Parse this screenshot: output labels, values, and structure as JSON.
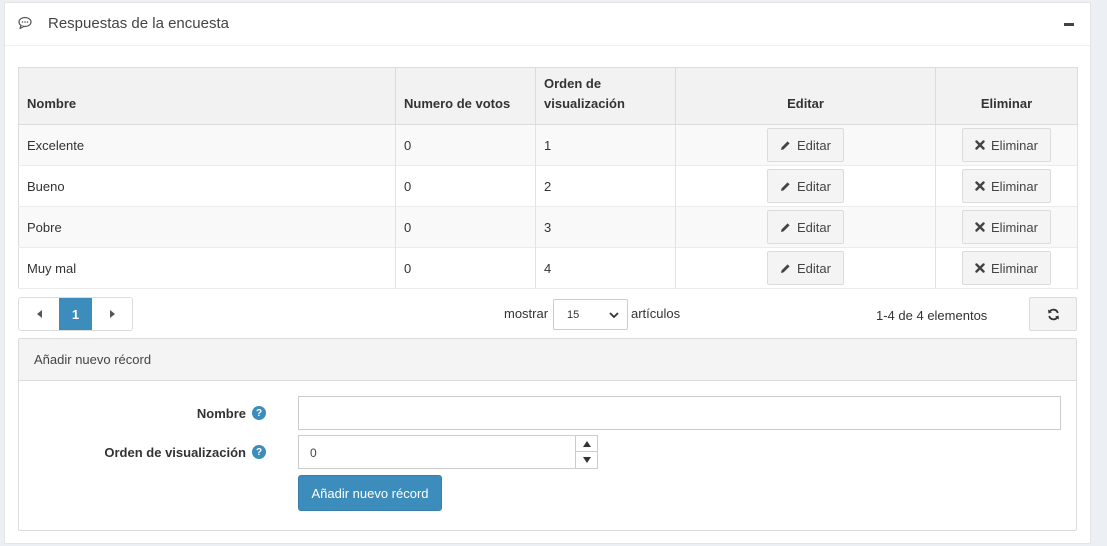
{
  "panel": {
    "title": "Respuestas de la encuesta",
    "icon": "comment-icon",
    "collapse_icon": "minus-icon"
  },
  "table": {
    "headers": {
      "name": "Nombre",
      "votes": "Numero de votos",
      "order_line1": "Orden de",
      "order_line2": "visualización",
      "edit": "Editar",
      "delete": "Eliminar"
    },
    "rows": [
      {
        "name": "Excelente",
        "votes": "0",
        "order": "1",
        "edit_label": "Editar",
        "delete_label": "Eliminar"
      },
      {
        "name": "Bueno",
        "votes": "0",
        "order": "2",
        "edit_label": "Editar",
        "delete_label": "Eliminar"
      },
      {
        "name": "Pobre",
        "votes": "0",
        "order": "3",
        "edit_label": "Editar",
        "delete_label": "Eliminar"
      },
      {
        "name": "Muy mal",
        "votes": "0",
        "order": "4",
        "edit_label": "Editar",
        "delete_label": "Eliminar"
      }
    ]
  },
  "pagination": {
    "current_page": "1",
    "show_label": "mostrar",
    "page_size": "15",
    "items_label": "artículos",
    "count_text": "1-4 de 4 elementos",
    "refresh_icon": "refresh-icon"
  },
  "add_form": {
    "header": "Añadir nuevo récord",
    "name_label": "Nombre",
    "name_value": "",
    "order_label": "Orden de visualización",
    "order_value": "0",
    "submit_label": "Añadir nuevo récord"
  },
  "colors": {
    "accent": "#3c8dbc",
    "header_bg": "#f2f2f2",
    "button_bg": "#f4f4f4"
  }
}
